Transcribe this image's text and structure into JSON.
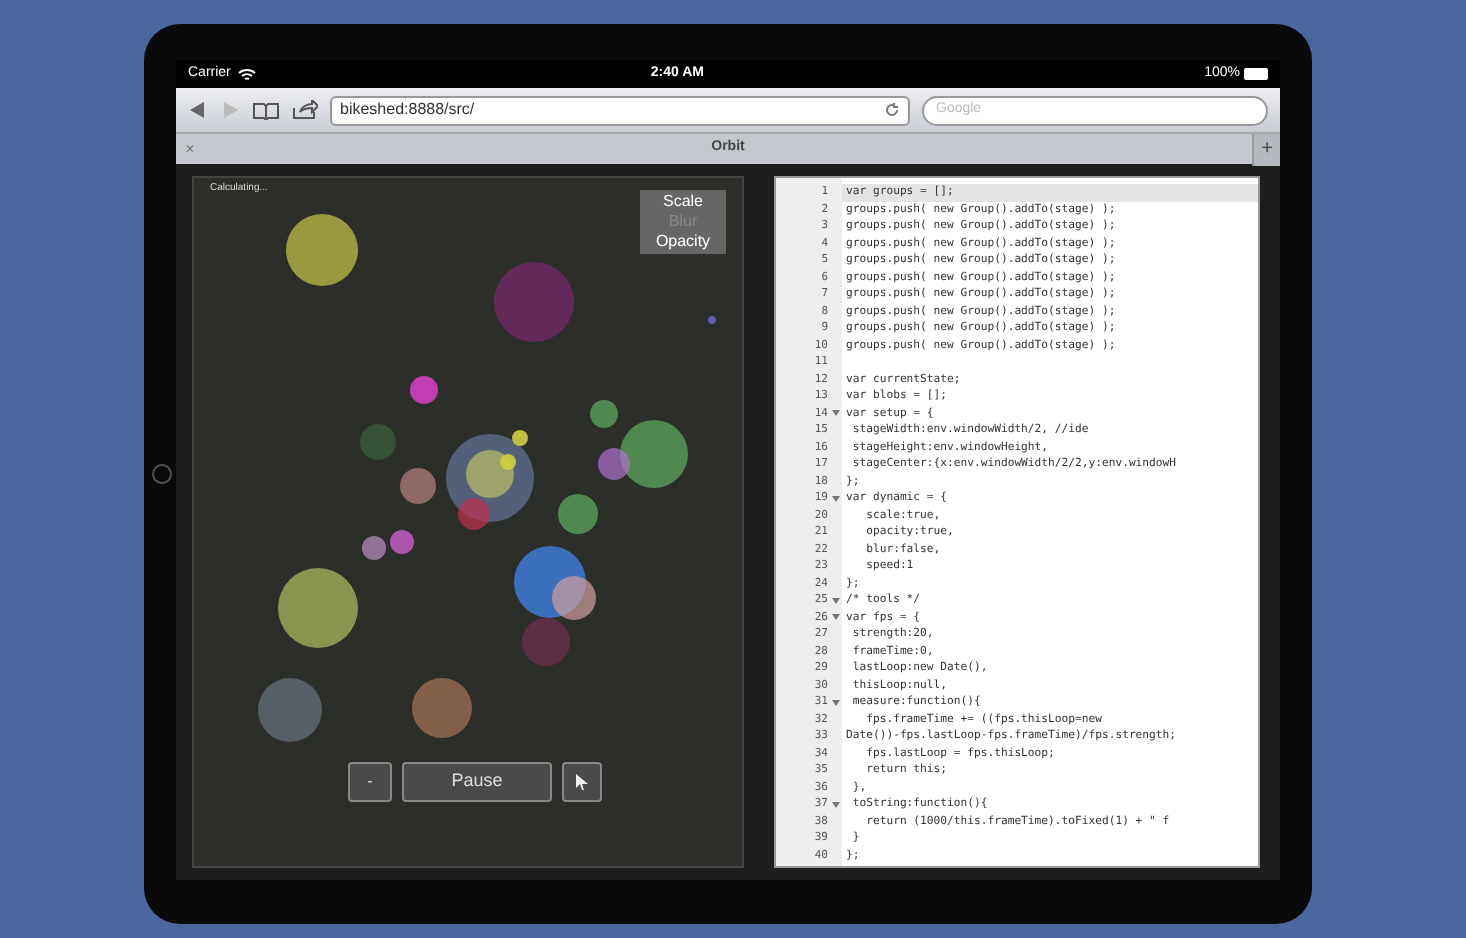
{
  "status_bar": {
    "carrier": "Carrier",
    "time": "2:40 AM",
    "battery": "100%"
  },
  "toolbar": {
    "url": "bikeshed:8888/src/",
    "search_placeholder": "Google"
  },
  "tab_bar": {
    "close": "×",
    "title": "Orbit",
    "add": "+"
  },
  "canvas": {
    "status": "Calculating...",
    "toggles": [
      {
        "label": "Scale",
        "on": true
      },
      {
        "label": "Blur",
        "on": false
      },
      {
        "label": "Opacity",
        "on": true
      }
    ],
    "controls": {
      "minus": "-",
      "pause": "Pause"
    }
  },
  "code": {
    "lines": [
      {
        "number": "1",
        "text": "var groups = [];",
        "fold": false,
        "selected": true
      },
      {
        "number": "2",
        "text": "groups.push( new Group().addTo(stage) );",
        "fold": false,
        "selected": false
      },
      {
        "number": "3",
        "text": "groups.push( new Group().addTo(stage) );",
        "fold": false,
        "selected": false
      },
      {
        "number": "4",
        "text": "groups.push( new Group().addTo(stage) );",
        "fold": false,
        "selected": false
      },
      {
        "number": "5",
        "text": "groups.push( new Group().addTo(stage) );",
        "fold": false,
        "selected": false
      },
      {
        "number": "6",
        "text": "groups.push( new Group().addTo(stage) );",
        "fold": false,
        "selected": false
      },
      {
        "number": "7",
        "text": "groups.push( new Group().addTo(stage) );",
        "fold": false,
        "selected": false
      },
      {
        "number": "8",
        "text": "groups.push( new Group().addTo(stage) );",
        "fold": false,
        "selected": false
      },
      {
        "number": "9",
        "text": "groups.push( new Group().addTo(stage) );",
        "fold": false,
        "selected": false
      },
      {
        "number": "10",
        "text": "groups.push( new Group().addTo(stage) );",
        "fold": false,
        "selected": false
      },
      {
        "number": "11",
        "fold": false,
        "selected": false
      },
      {
        "number": "12",
        "text": "var currentState;",
        "fold": false,
        "selected": false
      },
      {
        "number": "13",
        "text": "var blobs = [];",
        "fold": false,
        "selected": false
      },
      {
        "number": "14",
        "text": "var setup = {",
        "fold": true,
        "selected": false
      },
      {
        "number": "15",
        "text": " stageWidth:env.windowWidth/2, //ide",
        "fold": false,
        "selected": false
      },
      {
        "number": "16",
        "text": " stageHeight:env.windowHeight,",
        "fold": false,
        "selected": false
      },
      {
        "number": "17",
        "text": " stageCenter:{x:env.windowWidth/2/2,y:env.windowH",
        "fold": false,
        "selected": false
      },
      {
        "number": "18",
        "text": "};",
        "fold": false,
        "selected": false
      },
      {
        "number": "19",
        "text": "var dynamic = {",
        "fold": true,
        "selected": false
      },
      {
        "number": "20",
        "text": "   scale:true,",
        "fold": false,
        "selected": false
      },
      {
        "number": "21",
        "text": "   opacity:true,",
        "fold": false,
        "selected": false
      },
      {
        "number": "22",
        "text": "   blur:false,",
        "fold": false,
        "selected": false
      },
      {
        "number": "23",
        "text": "   speed:1",
        "fold": false,
        "selected": false
      },
      {
        "number": "24",
        "text": "};",
        "fold": false,
        "selected": false
      },
      {
        "number": "25",
        "text": "/* tools */",
        "fold": true,
        "selected": false
      },
      {
        "number": "26",
        "text": "var fps = {",
        "fold": true,
        "selected": false
      },
      {
        "number": "27",
        "text": " strength:20,",
        "fold": false,
        "selected": false
      },
      {
        "number": "28",
        "text": " frameTime:0,",
        "fold": false,
        "selected": false
      },
      {
        "number": "29",
        "text": " lastLoop:new Date(),",
        "fold": false,
        "selected": false
      },
      {
        "number": "30",
        "text": " thisLoop:null,",
        "fold": false,
        "selected": false
      },
      {
        "number": "31",
        "text": " measure:function(){",
        "fold": true,
        "selected": false
      },
      {
        "number": "32",
        "text": "   fps.frameTime += ((fps.thisLoop=new",
        "fold": false,
        "selected": false
      },
      {
        "number": "33",
        "text": "Date())-fps.lastLoop-fps.frameTime)/fps.strength;",
        "fold": false,
        "selected": false
      },
      {
        "number": "34",
        "text": "   fps.lastLoop = fps.thisLoop;",
        "fold": false,
        "selected": false
      },
      {
        "number": "35",
        "text": "   return this;",
        "fold": false,
        "selected": false
      },
      {
        "number": "36",
        "text": " },",
        "fold": false,
        "selected": false
      },
      {
        "number": "37",
        "text": " toString:function(){",
        "fold": true,
        "selected": false
      },
      {
        "number": "38",
        "text": "   return (1000/this.frameTime).toFixed(1) + \" f",
        "fold": false,
        "selected": false
      },
      {
        "number": "39",
        "text": " }",
        "fold": false,
        "selected": false
      },
      {
        "number": "40",
        "text": "};",
        "fold": false,
        "selected": false
      }
    ]
  }
}
